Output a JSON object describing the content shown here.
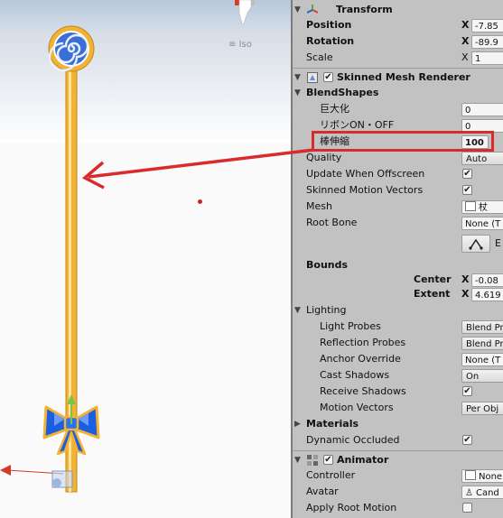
{
  "scene": {
    "view_mode": "Iso",
    "colors": {
      "wand_gold": "#f2b233",
      "candy_blue": "#3b6fd8",
      "bow_blue": "#1c5ee0",
      "highlight_red": "#d82c2c"
    }
  },
  "transform": {
    "title": "Transform",
    "position_label": "Position",
    "position_x": "-7.85",
    "rotation_label": "Rotation",
    "rotation_x": "-89.9",
    "scale_label": "Scale",
    "scale_x": "1",
    "axis_x": "X"
  },
  "skinned_mesh_renderer": {
    "title": "Skinned Mesh Renderer",
    "enabled": true,
    "blendshapes_label": "BlendShapes",
    "blendshapes": [
      {
        "name": "巨大化",
        "value": "0"
      },
      {
        "name": "リボンON・OFF",
        "value": "0"
      },
      {
        "name": "棒伸縮",
        "value": "100"
      }
    ],
    "quality_label": "Quality",
    "quality_value": "Auto",
    "update_offscreen_label": "Update When Offscreen",
    "update_offscreen": true,
    "skinned_motion_label": "Skinned Motion Vectors",
    "skinned_motion": true,
    "mesh_label": "Mesh",
    "mesh_value": "杖",
    "root_bone_label": "Root Bone",
    "root_bone_value": "None (T",
    "edit_bounds_label": "E",
    "bounds_label": "Bounds",
    "center_label": "Center",
    "center_x": "-0.08",
    "extent_label": "Extent",
    "extent_x": "4.619",
    "lighting_label": "Lighting",
    "light_probes_label": "Light Probes",
    "light_probes_value": "Blend Pr",
    "reflection_probes_label": "Reflection Probes",
    "reflection_probes_value": "Blend Pr",
    "anchor_override_label": "Anchor Override",
    "anchor_override_value": "None (T",
    "cast_shadows_label": "Cast Shadows",
    "cast_shadows_value": "On",
    "receive_shadows_label": "Receive Shadows",
    "receive_shadows": true,
    "motion_vectors_label": "Motion Vectors",
    "motion_vectors_value": "Per Obj",
    "materials_label": "Materials",
    "dynamic_occluded_label": "Dynamic Occluded",
    "dynamic_occluded": true
  },
  "animator": {
    "title": "Animator",
    "enabled": true,
    "controller_label": "Controller",
    "controller_value": "None",
    "avatar_label": "Avatar",
    "avatar_value": "Cand",
    "apply_root_motion_label": "Apply Root Motion",
    "apply_root_motion": false
  }
}
